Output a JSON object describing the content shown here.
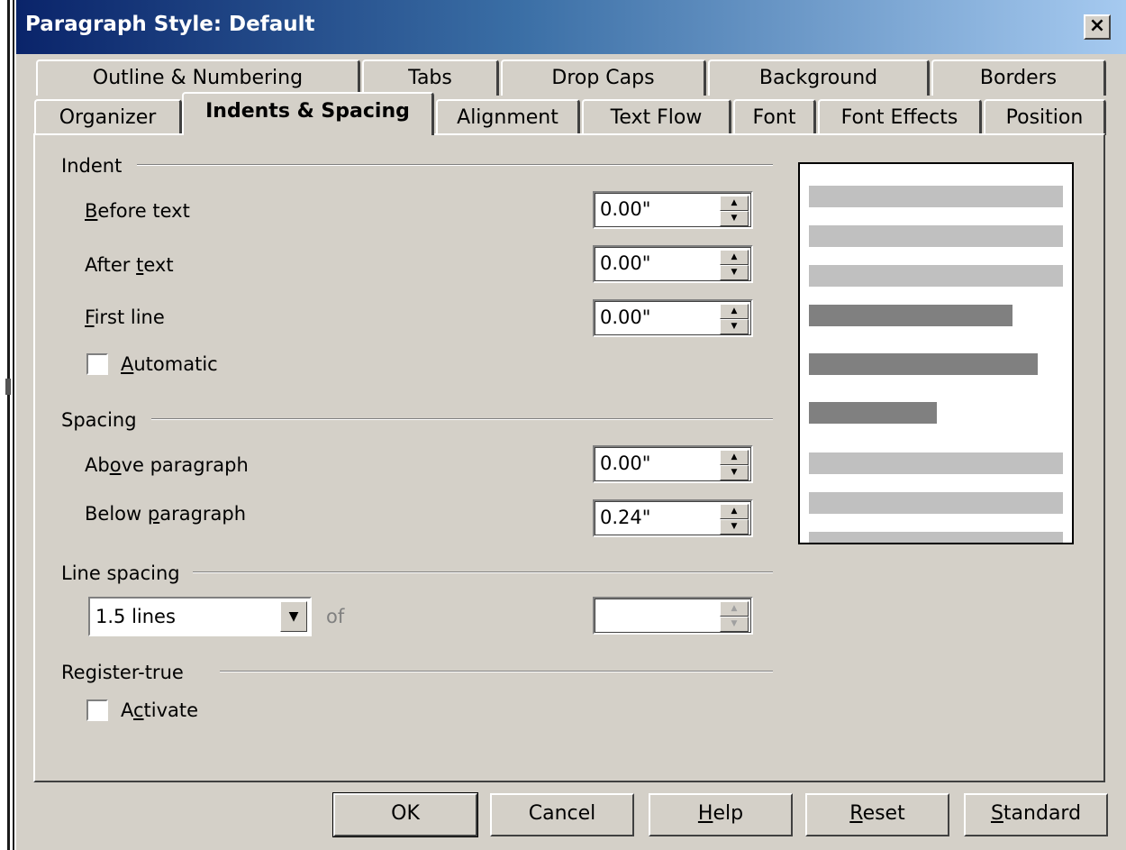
{
  "window": {
    "title": "Paragraph Style: Default",
    "close_glyph": "×"
  },
  "tabs_row1": [
    "Outline & Numbering",
    "Tabs",
    "Drop Caps",
    "Background",
    "Borders"
  ],
  "tabs_row2": [
    "Organizer",
    "Indents & Spacing",
    "Alignment",
    "Text Flow",
    "Font",
    "Font Effects",
    "Position"
  ],
  "active_tab": "Indents & Spacing",
  "indent": {
    "group_label": "Indent",
    "before_text": {
      "label": "Before text",
      "value": "0.00\""
    },
    "after_text": {
      "label": "After text",
      "value": "0.00\""
    },
    "first_line": {
      "label": "First line",
      "value": "0.00\""
    },
    "automatic": {
      "label": "Automatic",
      "checked": false
    }
  },
  "spacing": {
    "group_label": "Spacing",
    "above_paragraph": {
      "label": "Above paragraph",
      "value": "0.00\""
    },
    "below_paragraph": {
      "label": "Below paragraph",
      "value": "0.24\""
    }
  },
  "line_spacing": {
    "group_label": "Line spacing",
    "selected": "1.5 lines",
    "of_label": "of",
    "of_value": ""
  },
  "register_true": {
    "group_label": "Register-true",
    "activate": {
      "label": "Activate",
      "checked": false
    }
  },
  "buttons": {
    "ok": "OK",
    "cancel": "Cancel",
    "help": "Help",
    "reset": "Reset",
    "standard": "Standard"
  },
  "icons": {
    "close": "close-icon",
    "spin": "spin-arrows-icon",
    "dropdown": "dropdown-arrow-icon"
  }
}
